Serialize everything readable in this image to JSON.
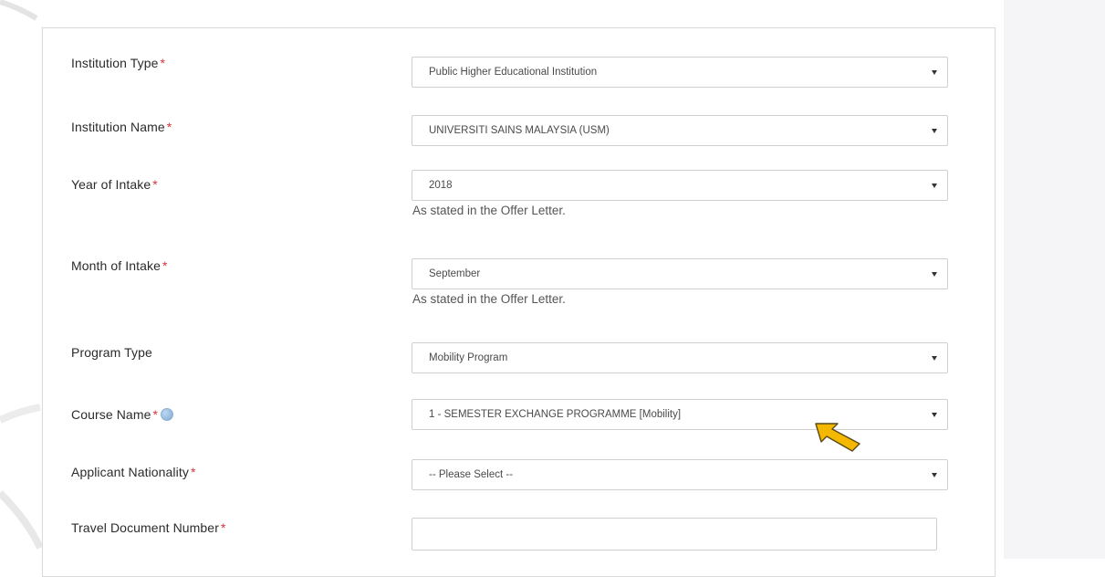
{
  "form": {
    "fields": [
      {
        "label": "Institution Type",
        "required": true,
        "type": "select",
        "value": "Public Higher Educational Institution"
      },
      {
        "label": "Institution Name",
        "required": true,
        "type": "select",
        "value": "UNIVERSITI SAINS MALAYSIA (USM)"
      },
      {
        "label": "Year of Intake",
        "required": true,
        "type": "select",
        "value": "2018",
        "hint": "As stated in the Offer Letter."
      },
      {
        "label": "Month of Intake",
        "required": true,
        "type": "select",
        "value": "September",
        "hint": "As stated in the Offer Letter."
      },
      {
        "label": "Program Type",
        "required": false,
        "type": "select",
        "value": "Mobility Program"
      },
      {
        "label": "Course Name",
        "required": true,
        "type": "select",
        "value": "1 - SEMESTER EXCHANGE PROGRAMME [Mobility]",
        "help_icon": "info-icon"
      },
      {
        "label": "Applicant Nationality",
        "required": true,
        "type": "select",
        "value": "-- Please Select --"
      },
      {
        "label": "Travel Document Number",
        "required": true,
        "type": "text",
        "value": ""
      }
    ],
    "required_marker": "*"
  },
  "colors": {
    "required": "#d9343b",
    "pointer_arrow": "#f5b800"
  },
  "annotations": {
    "pointer_icon": "arrow-pointer-icon"
  }
}
